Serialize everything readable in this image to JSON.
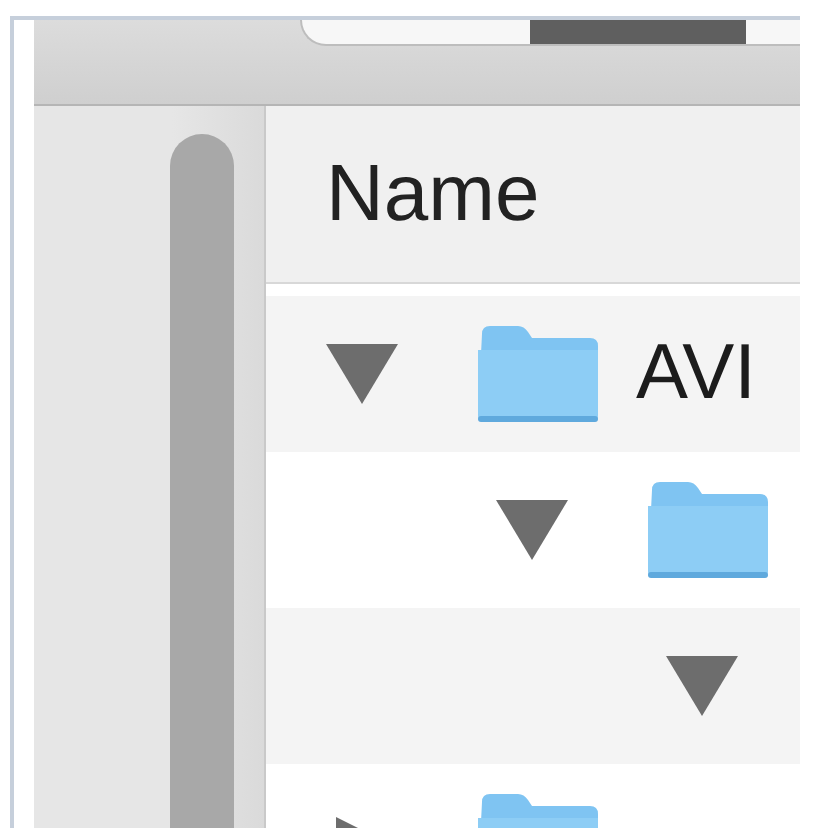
{
  "list": {
    "columns": [
      {
        "label": "Name"
      }
    ],
    "rows": [
      {
        "name": "AVI",
        "expanded": true,
        "children": [
          {
            "expanded": true,
            "children": [
              {
                "expanded": true
              }
            ]
          }
        ]
      },
      {
        "expanded": false
      }
    ]
  }
}
